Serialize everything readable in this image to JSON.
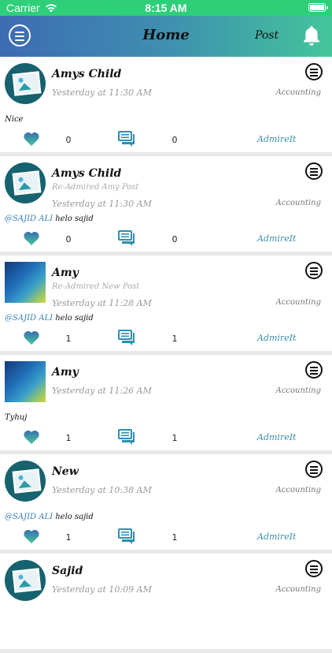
{
  "status_bar": {
    "carrier": "Carrier",
    "time": "8:15 AM",
    "wifi_icon": "wifi-icon",
    "battery_icon": "battery-icon"
  },
  "navbar": {
    "title": "Home",
    "post_label": "Post",
    "menu_icon": "hamburger-menu-icon",
    "bell_icon": "bell-icon",
    "gradient_colors": [
      "#3d6bb3",
      "#43c59a"
    ]
  },
  "feed": [
    {
      "name": "Amys Child",
      "sub": "",
      "time": "Yesterday at 11:30 AM",
      "category": "Accounting",
      "mention": "",
      "text": "Nice",
      "likes": "0",
      "comments": "0",
      "admire_label": "AdmireIt",
      "avatar": "photo-placeholder"
    },
    {
      "name": "Amys Child",
      "sub": "Re-Admired Amy Post",
      "time": "Yesterday at 11:30 AM",
      "category": "Accounting",
      "mention": "@SAJID ALI",
      "text": " helo sajid",
      "likes": "0",
      "comments": "0",
      "admire_label": "AdmireIt",
      "avatar": "photo-placeholder"
    },
    {
      "name": "Amy",
      "sub": "Re-Admired New Post",
      "time": "Yesterday at 11:28 AM",
      "category": "Accounting",
      "mention": "@SAJID ALI",
      "text": " helo sajid",
      "likes": "1",
      "comments": "1",
      "admire_label": "AdmireIt",
      "avatar": "mosaic"
    },
    {
      "name": "Amy",
      "sub": "",
      "time": "Yesterday at 11:26 AM",
      "category": "Accounting",
      "mention": "",
      "text": "Tyhuj",
      "likes": "1",
      "comments": "1",
      "admire_label": "AdmireIt",
      "avatar": "mosaic"
    },
    {
      "name": "New",
      "sub": "",
      "time": "Yesterday at 10:38 AM",
      "category": "Accounting",
      "mention": "@SAJID ALI",
      "text": " helo sajid",
      "likes": "1",
      "comments": "1",
      "admire_label": "AdmireIt",
      "avatar": "photo-placeholder"
    },
    {
      "name": "Sajid",
      "sub": "",
      "time": "Yesterday at 10:09 AM",
      "category": "Accounting",
      "mention": "",
      "text": "",
      "likes": "",
      "comments": "",
      "admire_label": "",
      "avatar": "photo-placeholder"
    }
  ],
  "colors": {
    "status_bar": "#2fcf7a",
    "admire": "#3a8fa5",
    "mention": "#3a7fb8",
    "like_heart": "#3aa3a0",
    "comment_bubble": "#2f8fae"
  }
}
